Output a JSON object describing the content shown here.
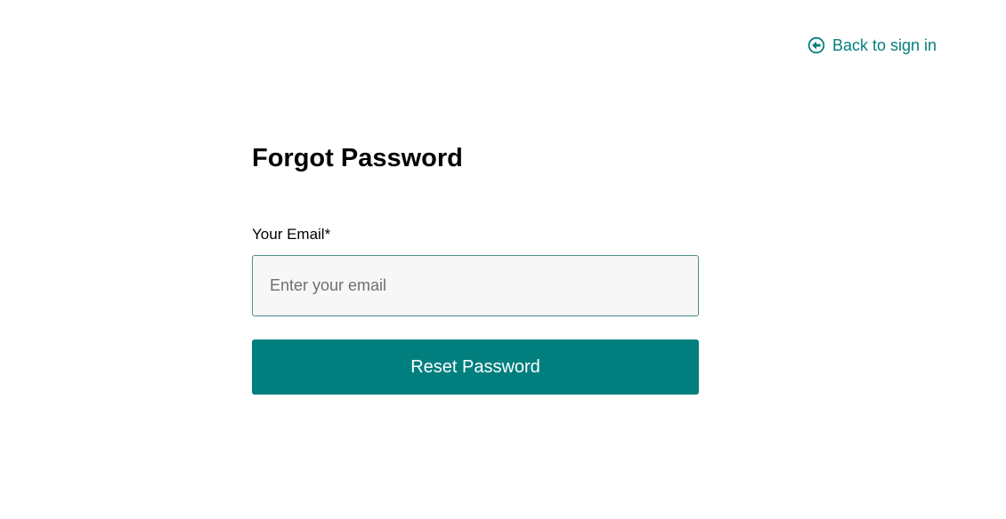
{
  "header": {
    "back_link": {
      "label": "Back to sign in",
      "icon": "arrow-left-circle-icon"
    }
  },
  "form": {
    "title": "Forgot Password",
    "email_label": "Your Email*",
    "email_placeholder": "Enter your email",
    "email_value": "",
    "submit_label": "Reset Password"
  },
  "colors": {
    "accent": "#017f7f",
    "input_border": "#4b8d88",
    "input_background": "#f7f7f7",
    "page_background": "#ffffff"
  }
}
